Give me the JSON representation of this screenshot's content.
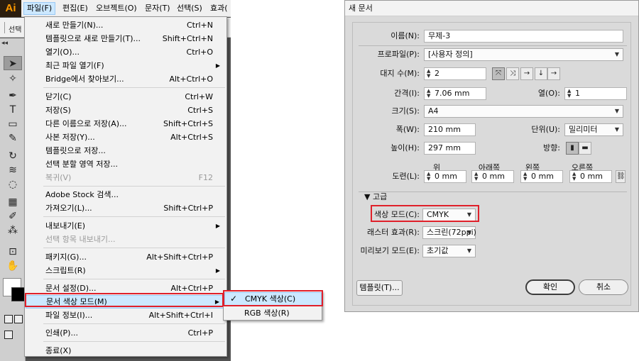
{
  "app": {
    "logo": "Ai"
  },
  "menubar": {
    "items": [
      {
        "label": "파일(F)",
        "active": true
      },
      {
        "label": "편집(E)"
      },
      {
        "label": "오브젝트(O)"
      },
      {
        "label": "문자(T)"
      },
      {
        "label": "선택(S)"
      },
      {
        "label": "효과("
      }
    ]
  },
  "control_bar": {
    "label": "선택"
  },
  "file_menu": {
    "items": [
      {
        "label": "새로 만들기(N)...",
        "shortcut": "Ctrl+N"
      },
      {
        "label": "템플릿으로 새로 만들기(T)...",
        "shortcut": "Shift+Ctrl+N"
      },
      {
        "label": "열기(O)...",
        "shortcut": "Ctrl+O"
      },
      {
        "label": "최근 파일 열기(F)",
        "shortcut": ""
      },
      {
        "label": "Bridge에서 찾아보기...",
        "shortcut": "Alt+Ctrl+O"
      },
      {
        "label": "닫기(C)",
        "shortcut": "Ctrl+W"
      },
      {
        "label": "저장(S)",
        "shortcut": "Ctrl+S"
      },
      {
        "label": "다른 이름으로 저장(A)...",
        "shortcut": "Shift+Ctrl+S"
      },
      {
        "label": "사본 저장(Y)...",
        "shortcut": "Alt+Ctrl+S"
      },
      {
        "label": "템플릿으로 저장...",
        "shortcut": ""
      },
      {
        "label": "선택 분할 영역 저장...",
        "shortcut": ""
      },
      {
        "label": "복귀(V)",
        "shortcut": "F12"
      },
      {
        "label": "Adobe Stock 검색...",
        "shortcut": ""
      },
      {
        "label": "가져오기(L)...",
        "shortcut": "Shift+Ctrl+P"
      },
      {
        "label": "내보내기(E)",
        "shortcut": ""
      },
      {
        "label": "선택 항목 내보내기...",
        "shortcut": ""
      },
      {
        "label": "패키지(G)...",
        "shortcut": "Alt+Shift+Ctrl+P"
      },
      {
        "label": "스크립트(R)",
        "shortcut": ""
      },
      {
        "label": "문서 설정(D)...",
        "shortcut": "Alt+Ctrl+P"
      },
      {
        "label": "문서 색상 모드(M)",
        "shortcut": ""
      },
      {
        "label": "파일 정보(I)...",
        "shortcut": "Alt+Shift+Ctrl+I"
      },
      {
        "label": "인쇄(P)...",
        "shortcut": "Ctrl+P"
      },
      {
        "label": "종료(X)",
        "shortcut": ""
      }
    ]
  },
  "color_mode_submenu": {
    "items": [
      {
        "label": "CMYK 색상(C)",
        "checked": true
      },
      {
        "label": "RGB 색상(R)",
        "checked": false
      }
    ],
    "check_glyph": "✓"
  },
  "dialog": {
    "title": "새 문서",
    "name": {
      "label": "이름(N):",
      "value": "무제-3"
    },
    "profile": {
      "label": "프로파일(P):",
      "value": "[사용자 정의]"
    },
    "artboards": {
      "label": "대지 수(M):",
      "value": "2"
    },
    "spacing": {
      "label": "간격(I):",
      "value": "7.06 mm"
    },
    "columns": {
      "label": "열(O):",
      "value": "1"
    },
    "size": {
      "label": "크기(S):",
      "value": "A4"
    },
    "width": {
      "label": "폭(W):",
      "value": "210 mm"
    },
    "units": {
      "label": "단위(U):",
      "value": "밀리미터"
    },
    "height": {
      "label": "높이(H):",
      "value": "297 mm"
    },
    "orientation": {
      "label": "방향:"
    },
    "bleed": {
      "label": "도련(L):",
      "top": {
        "label": "위",
        "value": "0 mm"
      },
      "bottom": {
        "label": "아래쪽",
        "value": "0 mm"
      },
      "left": {
        "label": "왼쪽",
        "value": "0 mm"
      },
      "right": {
        "label": "오른쪽",
        "value": "0 mm"
      }
    },
    "advanced": {
      "label": "고급"
    },
    "color_mode": {
      "label": "색상 모드(C):",
      "value": "CMYK"
    },
    "raster": {
      "label": "래스터 효과(R):",
      "value": "스크린(72ppi)"
    },
    "preview": {
      "label": "미리보기 모드(E):",
      "value": "초기값"
    },
    "buttons": {
      "templates": "템플릿(T)...",
      "ok": "확인",
      "cancel": "취소"
    }
  },
  "colors": {
    "highlight": "#cce8ff",
    "annotation_red": "#e0202a",
    "ai_brand": "#ff9a00"
  }
}
